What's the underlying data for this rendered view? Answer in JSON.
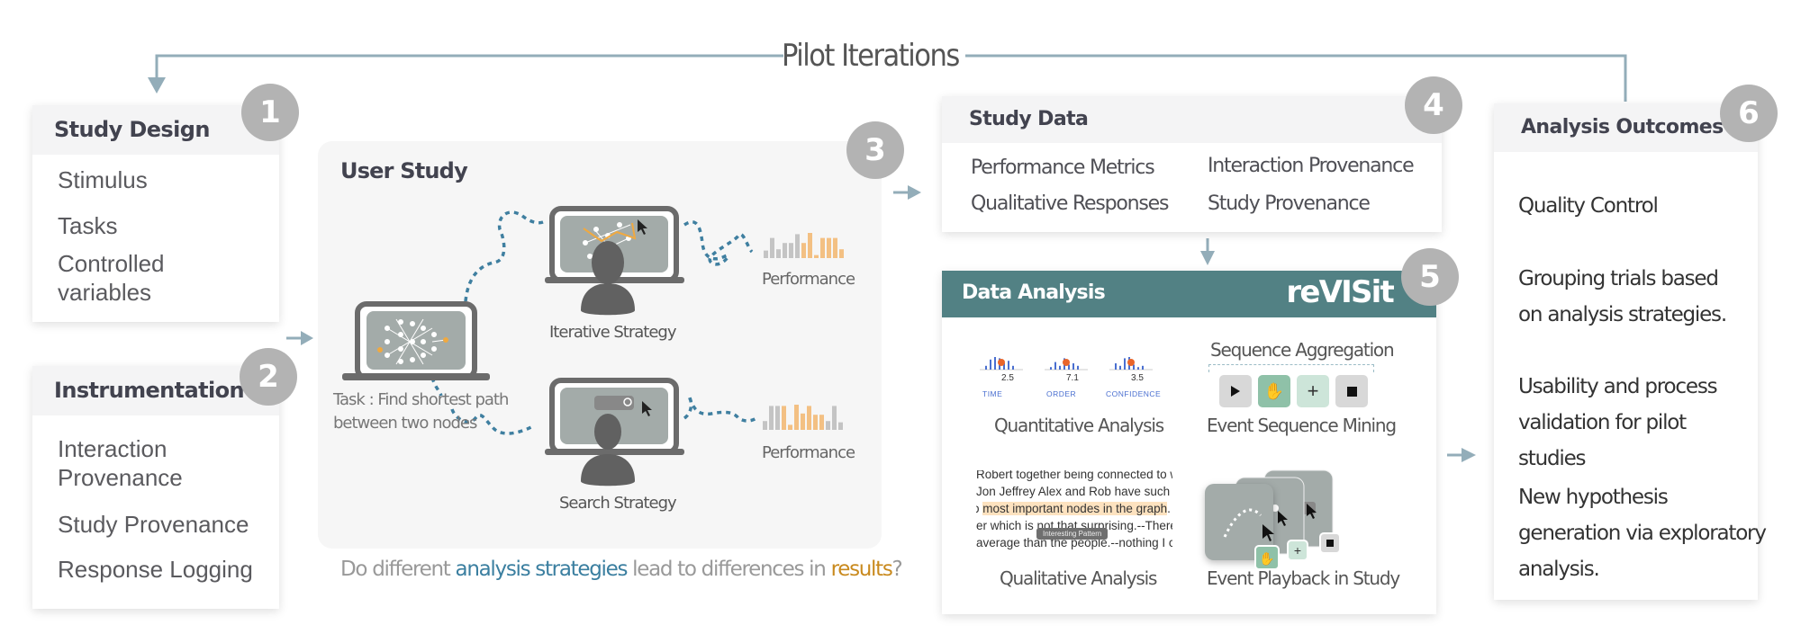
{
  "loop": {
    "label": "Pilot Iterations"
  },
  "colors": {
    "accent_teal": "#528184",
    "arrow": "#93adb9",
    "dotted_path": "#3f7fa0",
    "highlight_blue": "#3b7fa0",
    "highlight_orange": "#c98a1e",
    "badge": "#b3b3b3",
    "bar_gray": "#c4c4c4",
    "bar_orange": "#f3c083"
  },
  "study_design": {
    "badge": "1",
    "title": "Study Design",
    "items": [
      "Stimulus",
      "Tasks",
      "Controlled variables"
    ]
  },
  "instrumentation": {
    "badge": "2",
    "title": "Instrumentation",
    "items": [
      "Interaction Provenance",
      "Study Provenance",
      "Response Logging"
    ]
  },
  "user_study": {
    "badge": "3",
    "title": "User Study",
    "task_label_line1": "Task : Find shortest path",
    "task_label_line2": "between two nodes",
    "strategies": [
      {
        "label": "Iterative Strategy",
        "result_label": "Performance"
      },
      {
        "label": "Search Strategy",
        "result_label": "Performance"
      }
    ],
    "question": {
      "prefix": "Do different ",
      "blue": "analysis strategies",
      "middle": " lead to differences in ",
      "orange": "results",
      "suffix": "?"
    },
    "performance_bars": [
      {
        "gray_before": [
          0.3,
          0.8,
          0.35,
          0.6,
          0.6,
          0.95
        ],
        "orange": [
          0.6,
          1.0,
          0.12,
          0.8,
          0.8,
          0.8,
          0.35
        ],
        "gray_after": []
      },
      {
        "gray_before": [
          0.35,
          0.95,
          0.95
        ],
        "orange": [
          0.95,
          0.2,
          1.0,
          0.65,
          0.95,
          0.6,
          0.6
        ],
        "gray_after": [
          0.35,
          0.95,
          0.3
        ]
      }
    ]
  },
  "study_data": {
    "badge": "4",
    "title": "Study Data",
    "items": [
      "Performance Metrics",
      "Interaction Provenance",
      "Qualitative Responses",
      "Study Provenance"
    ]
  },
  "data_analysis": {
    "badge": "5",
    "title": "Data Analysis",
    "brand": "reVISit",
    "quantitative": {
      "caption": "Quantitative Analysis",
      "metrics": [
        {
          "label": "TIME",
          "value": "2.5"
        },
        {
          "label": "ORDER",
          "value": "7.1"
        },
        {
          "label": "CONFIDENCE",
          "value": "3.5"
        }
      ]
    },
    "sequence": {
      "heading": "Sequence Aggregation",
      "caption": "Event Sequence Mining",
      "buttons": [
        "play-icon",
        "hand-icon",
        "plus-icon",
        "stop-icon"
      ]
    },
    "qualitative": {
      "caption": "Qualitative Analysis",
      "lines": [
        "Robert together being connected to w",
        "Jon Jeffrey Alex and Rob have such la",
        "most important nodes in the graph",
        "er which is not that surprising.--There",
        "average than the people.--nothing I ca"
      ],
      "line3_prefix": "o ",
      "line3_suffix": ". I",
      "tooltip": "Interesting Pattern"
    },
    "playback": {
      "caption": "Event Playback in Study"
    }
  },
  "analysis_outcomes": {
    "badge": "6",
    "title": "Analysis Outcomes",
    "items": [
      "Quality Control",
      "Grouping trials based on analysis strategies.",
      "Usability and process validation for pilot studies",
      "New hypothesis generation via exploratory analysis."
    ]
  }
}
